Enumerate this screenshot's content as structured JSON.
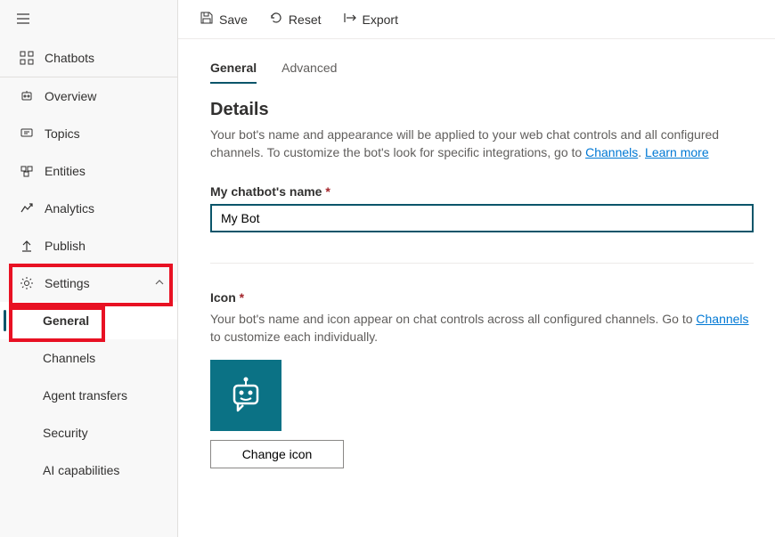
{
  "toolbar": {
    "save": "Save",
    "reset": "Reset",
    "export": "Export"
  },
  "sidebar": {
    "chatbots": "Chatbots",
    "overview": "Overview",
    "topics": "Topics",
    "entities": "Entities",
    "analytics": "Analytics",
    "publish": "Publish",
    "settings": "Settings",
    "settings_children": {
      "general": "General",
      "channels": "Channels",
      "agent_transfers": "Agent transfers",
      "security": "Security",
      "ai_capabilities": "AI capabilities"
    }
  },
  "tabs": {
    "general": "General",
    "advanced": "Advanced"
  },
  "details": {
    "heading": "Details",
    "desc_prefix": "Your bot's name and appearance will be applied to your web chat controls and all configured channels. To customize the bot's look for specific integrations, go to ",
    "channels_link": "Channels",
    "desc_mid": ". ",
    "learn_more": "Learn more"
  },
  "name_field": {
    "label": "My chatbot's name",
    "value": "My Bot"
  },
  "icon_section": {
    "label": "Icon",
    "help_prefix": "Your bot's name and icon appear on chat controls across all configured channels. Go to ",
    "channels_link": "Channels",
    "help_suffix": " to customize each individually.",
    "change_btn": "Change icon"
  }
}
